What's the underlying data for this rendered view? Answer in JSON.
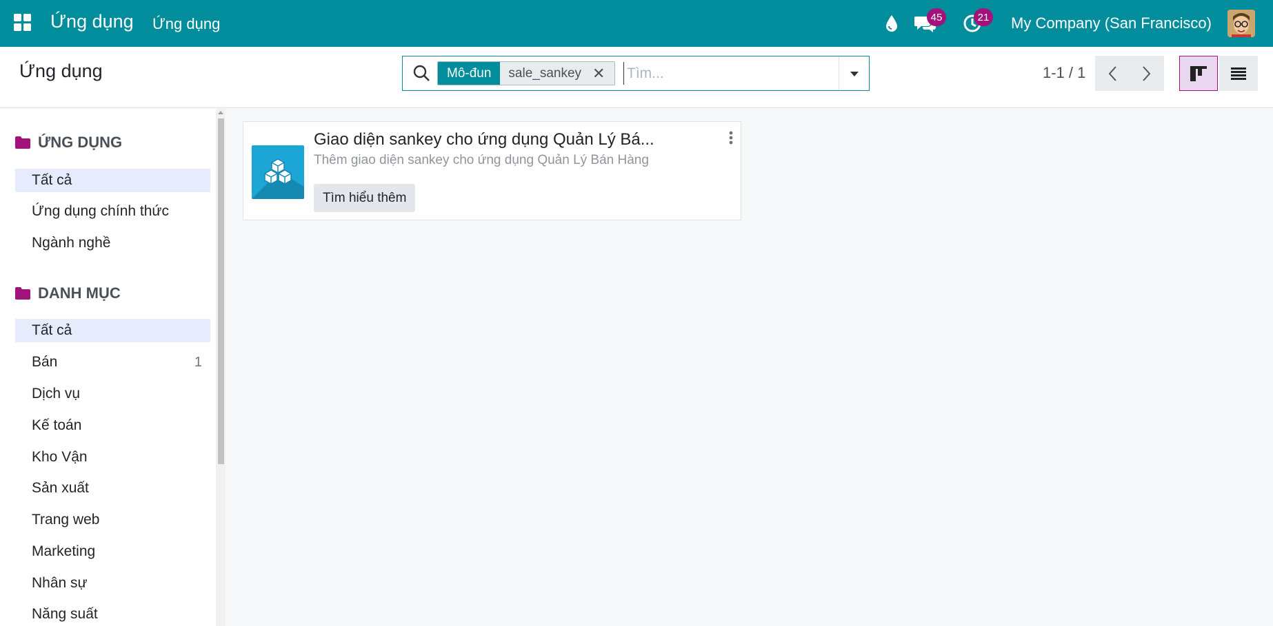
{
  "navbar": {
    "brand": "Ứng dụng",
    "menu_label": "Ứng dụng",
    "messages_count": "45",
    "activities_count": "21",
    "company": "My Company (San Francisco)",
    "bg_color": "#018d9c",
    "badge_color": "#a2127a"
  },
  "control": {
    "page_title": "Ứng dụng",
    "facet_label": "Mô-đun",
    "facet_value": "sale_sankey",
    "facet_remove": "✕",
    "search_placeholder": "Tìm...",
    "pager_value": "1-1 / 1"
  },
  "sidebar": {
    "apps_heading": "ỨNG DỤNG",
    "apps_items": [
      {
        "label": "Tất cả"
      },
      {
        "label": "Ứng dụng chính thức"
      },
      {
        "label": "Ngành nghề"
      }
    ],
    "categories_heading": "DANH MỤC",
    "category_items": [
      {
        "label": "Tất cả",
        "count": ""
      },
      {
        "label": "Bán",
        "count": "1"
      },
      {
        "label": "Dịch vụ",
        "count": ""
      },
      {
        "label": "Kế toán",
        "count": ""
      },
      {
        "label": "Kho Vận",
        "count": ""
      },
      {
        "label": "Sản xuất",
        "count": ""
      },
      {
        "label": "Trang web",
        "count": ""
      },
      {
        "label": "Marketing",
        "count": ""
      },
      {
        "label": "Nhân sự",
        "count": ""
      },
      {
        "label": "Năng suất",
        "count": ""
      }
    ]
  },
  "card": {
    "title": "Giao diện sankey cho ứng dụng Quản Lý Bá...",
    "summary": "Thêm giao diện sankey cho ứng dụng Quản Lý Bán Hàng",
    "button_label": "Tìm hiểu thêm"
  }
}
